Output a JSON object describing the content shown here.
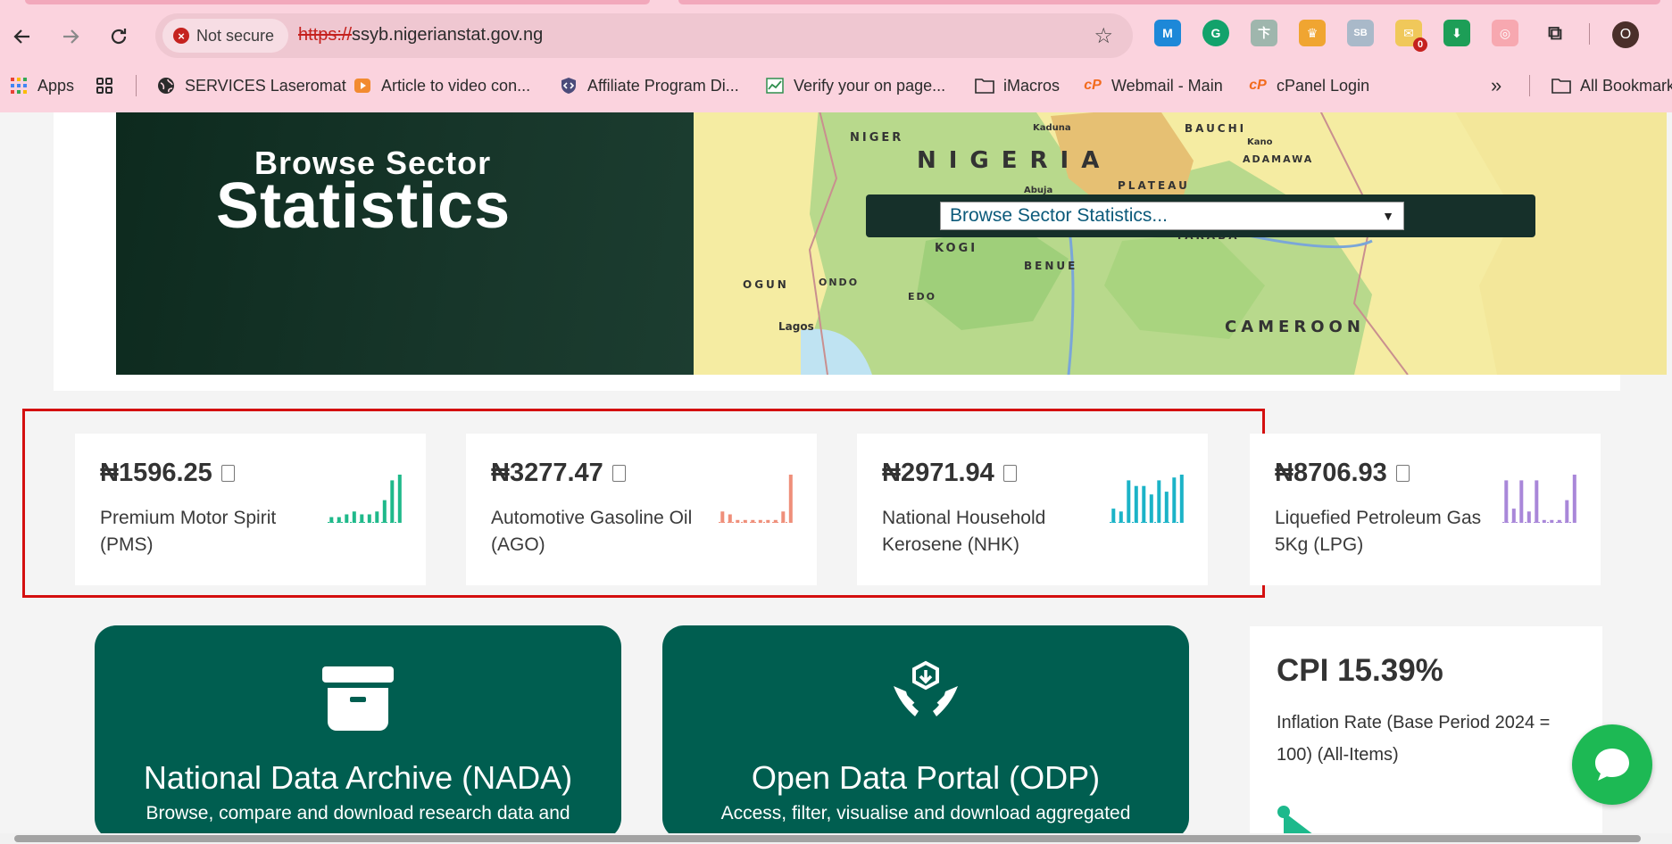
{
  "browser": {
    "security_label": "Not secure",
    "url_scheme": "https://",
    "url_host": "ssyb.nigerianstat.gov.ng",
    "bookmarks": [
      {
        "label": "Apps",
        "icon": "apps-grid-icon"
      },
      {
        "label": "",
        "icon": "tab-groups-icon"
      },
      {
        "label": "SERVICES Laseromat",
        "icon": "globe-icon"
      },
      {
        "label": "Article to video con...",
        "icon": "video-icon"
      },
      {
        "label": "Affiliate Program Di...",
        "icon": "code-shield-icon"
      },
      {
        "label": "Verify your on page...",
        "icon": "chart-icon"
      },
      {
        "label": "iMacros",
        "icon": "folder-icon"
      },
      {
        "label": "Webmail - Main",
        "icon": "cpanel-icon"
      },
      {
        "label": "cPanel Login",
        "icon": "cpanel-icon"
      },
      {
        "label": "All Bookmarks",
        "icon": "folder-icon"
      }
    ],
    "overflow_label": "»",
    "extension_badge": "0",
    "profile_initial": "O"
  },
  "hero": {
    "title_line1": "Browse Sector",
    "title_line2": "Statistics",
    "select_placeholder": "Browse Sector Statistics...",
    "map_labels": [
      "NIGER",
      "NIGERIA",
      "KOGI",
      "BENUE",
      "TARABA",
      "PLATEAU",
      "ADAMAWA",
      "OGUN",
      "ONDO",
      "EDO",
      "CAMEROON",
      "Lagos",
      "Abuja",
      "Kaduna",
      "BAUCHI",
      "Kano"
    ]
  },
  "stats": [
    {
      "price": "₦1596.25",
      "label_line1": "Premium Motor Spirit",
      "label_line2": "(PMS)",
      "color": "#1fb98a",
      "spark": [
        2,
        2,
        3,
        4,
        3,
        3,
        4,
        8,
        15,
        17
      ]
    },
    {
      "price": "₦3277.47",
      "label_line1": "Automotive Gasoline Oil",
      "label_line2": "(AGO)",
      "color": "#ef8f7a",
      "spark": [
        4,
        3,
        1,
        1,
        1,
        1,
        1,
        1,
        4,
        17
      ]
    },
    {
      "price": "₦2971.94",
      "label_line1": "National Household",
      "label_line2": "Kerosene (NHK)",
      "color": "#1bb3c7",
      "spark": [
        5,
        4,
        15,
        13,
        13,
        10,
        15,
        11,
        16,
        17
      ]
    },
    {
      "price": "₦8706.93",
      "label_line1": "Liquefied Petroleum Gas",
      "label_line2": "5Kg (LPG)",
      "color": "#a987d9",
      "spark": [
        15,
        5,
        15,
        4,
        15,
        1,
        1,
        1,
        8,
        17
      ]
    }
  ],
  "portals": [
    {
      "title": "National Data Archive (NADA)",
      "desc": "Browse, compare and download research data and"
    },
    {
      "title": "Open Data Portal (ODP)",
      "desc": "Access, filter, visualise and download aggregated"
    }
  ],
  "cpi": {
    "title": "CPI 15.39%",
    "desc": "Inflation Rate (Base Period 2024 = 100) (All-Items)"
  }
}
